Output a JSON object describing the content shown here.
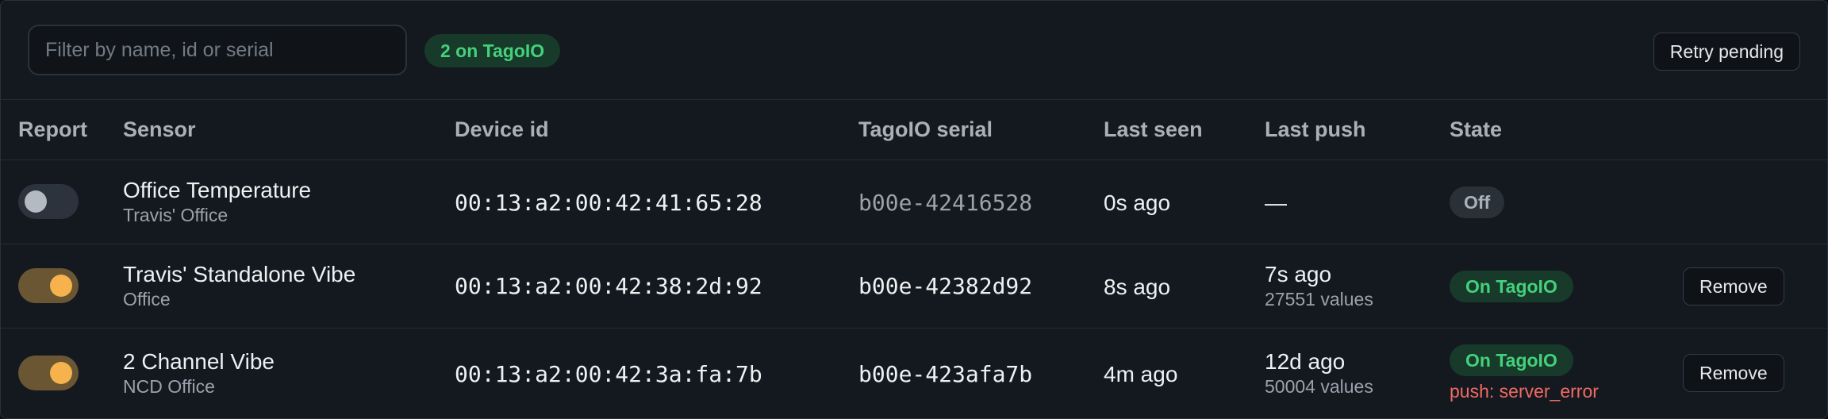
{
  "toolbar": {
    "filter_placeholder": "Filter by name, id or serial",
    "filter_value": "",
    "count_badge": "2 on TagoIO",
    "retry_label": "Retry pending"
  },
  "columns": {
    "report": "Report",
    "sensor": "Sensor",
    "device_id": "Device id",
    "serial": "TagoIO serial",
    "last_seen": "Last seen",
    "last_push": "Last push",
    "state": "State"
  },
  "rows": [
    {
      "report_enabled": false,
      "sensor_name": "Office Temperature",
      "sensor_location": "Travis' Office",
      "device_id": "00:13:a2:00:42:41:65:28",
      "serial": "b00e-42416528",
      "last_seen": "0s ago",
      "last_push": "—",
      "push_values": "",
      "state": "Off",
      "error": "",
      "action": ""
    },
    {
      "report_enabled": true,
      "sensor_name": "Travis' Standalone Vibe",
      "sensor_location": "Office",
      "device_id": "00:13:a2:00:42:38:2d:92",
      "serial": "b00e-42382d92",
      "last_seen": "8s ago",
      "last_push": "7s ago",
      "push_values": "27551 values",
      "state": "On TagoIO",
      "error": "",
      "action": "Remove"
    },
    {
      "report_enabled": true,
      "sensor_name": "2 Channel Vibe",
      "sensor_location": "NCD Office",
      "device_id": "00:13:a2:00:42:3a:fa:7b",
      "serial": "b00e-423afa7b",
      "last_seen": "4m ago",
      "last_push": "12d ago",
      "push_values": "50004 values",
      "state": "On TagoIO",
      "error": "push: server_error",
      "action": "Remove"
    }
  ],
  "colors": {
    "background": "#141920",
    "accent_green": "#44d17a",
    "toggle_on": "#f6b24d",
    "error": "#f26a63"
  }
}
